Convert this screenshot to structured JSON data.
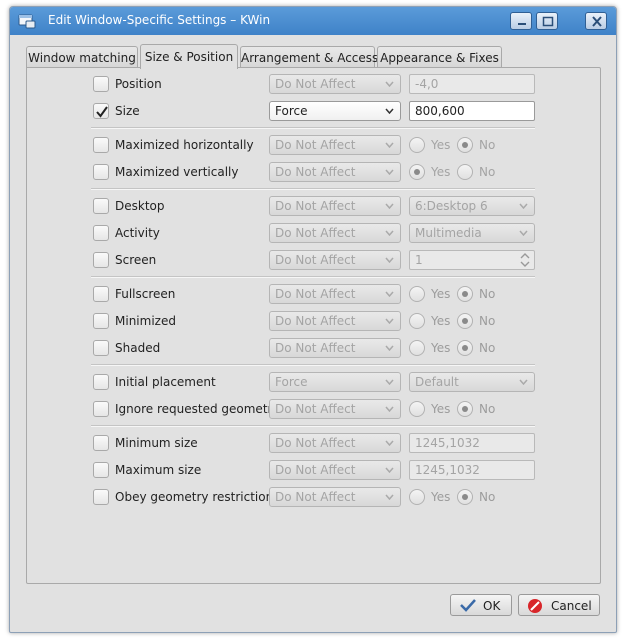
{
  "window": {
    "title": "Edit Window-Specific Settings – KWin",
    "colors": {
      "titlebar": "#4a8ed2",
      "background": "#e1e1e1"
    }
  },
  "tabs": [
    {
      "label": "Window matching",
      "active": false
    },
    {
      "label": "Size & Position",
      "active": true
    },
    {
      "label": "Arrangement & Access",
      "active": false
    },
    {
      "label": "Appearance & Fixes",
      "active": false
    }
  ],
  "rows": {
    "position": {
      "label": "Position",
      "checked": false,
      "policy": "Do Not Affect",
      "value": "-4,0"
    },
    "size": {
      "label": "Size",
      "checked": true,
      "policy": "Force",
      "value": "800,600"
    },
    "max_horizontal": {
      "label": "Maximized horizontally",
      "checked": false,
      "policy": "Do Not Affect",
      "yes": "Yes",
      "no": "No",
      "selected": "no"
    },
    "max_vertical": {
      "label": "Maximized vertically",
      "checked": false,
      "policy": "Do Not Affect",
      "yes": "Yes",
      "no": "No",
      "selected": "yes"
    },
    "desktop": {
      "label": "Desktop",
      "checked": false,
      "policy": "Do Not Affect",
      "value": "6:Desktop 6"
    },
    "activity": {
      "label": "Activity",
      "checked": false,
      "policy": "Do Not Affect",
      "value": "Multimedia"
    },
    "screen": {
      "label": "Screen",
      "checked": false,
      "policy": "Do Not Affect",
      "value": "1"
    },
    "fullscreen": {
      "label": "Fullscreen",
      "checked": false,
      "policy": "Do Not Affect",
      "yes": "Yes",
      "no": "No",
      "selected": "no"
    },
    "minimized": {
      "label": "Minimized",
      "checked": false,
      "policy": "Do Not Affect",
      "yes": "Yes",
      "no": "No",
      "selected": "no"
    },
    "shaded": {
      "label": "Shaded",
      "checked": false,
      "policy": "Do Not Affect",
      "yes": "Yes",
      "no": "No",
      "selected": "no"
    },
    "initial_placement": {
      "label": "Initial placement",
      "checked": false,
      "policy": "Force",
      "value": "Default"
    },
    "ignore_geometry": {
      "label": "Ignore requested geometry",
      "checked": false,
      "policy": "Do Not Affect",
      "yes": "Yes",
      "no": "No",
      "selected": "no"
    },
    "min_size": {
      "label": "Minimum size",
      "checked": false,
      "policy": "Do Not Affect",
      "value": "1245,1032"
    },
    "max_size": {
      "label": "Maximum size",
      "checked": false,
      "policy": "Do Not Affect",
      "value": "1245,1032"
    },
    "obey_geometry": {
      "label": "Obey geometry restrictions",
      "checked": false,
      "policy": "Do Not Affect",
      "yes": "Yes",
      "no": "No",
      "selected": "no"
    }
  },
  "buttons": {
    "ok": "OK",
    "cancel": "Cancel"
  }
}
